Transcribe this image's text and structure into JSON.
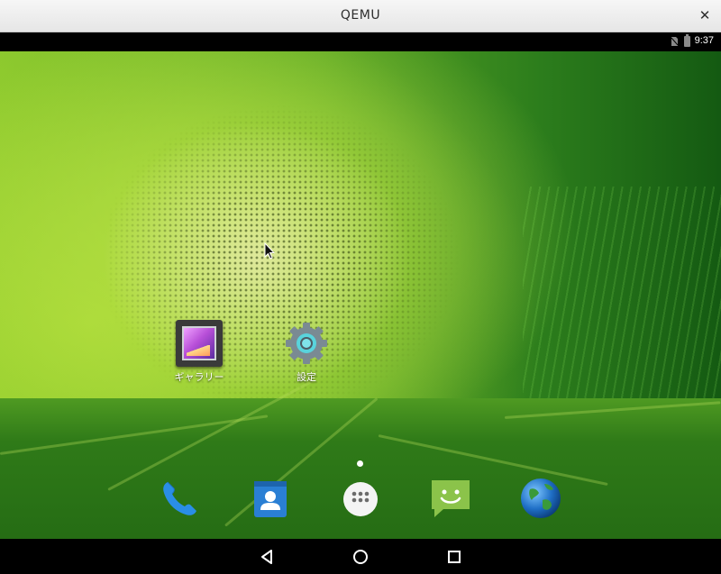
{
  "window": {
    "title": "QEMU",
    "close_label": "✕"
  },
  "status_bar": {
    "time": "9:37",
    "icons": [
      "no-sim-icon",
      "battery-icon"
    ]
  },
  "desktop": {
    "apps": [
      {
        "label": "ギャラリー",
        "icon": "gallery-icon"
      },
      {
        "label": "設定",
        "icon": "settings-gear-icon"
      }
    ],
    "page_indicator": {
      "pages": 1,
      "current": 1
    }
  },
  "dock": [
    {
      "icon": "phone-icon"
    },
    {
      "icon": "contacts-icon"
    },
    {
      "icon": "app-drawer-icon"
    },
    {
      "icon": "messaging-icon"
    },
    {
      "icon": "browser-globe-icon"
    }
  ],
  "nav_bar": {
    "buttons": [
      "back-icon",
      "home-icon",
      "recents-icon"
    ]
  },
  "colors": {
    "wallpaper_light": "#c8e36a",
    "wallpaper_dark": "#145a12",
    "system_bar": "#000000"
  }
}
